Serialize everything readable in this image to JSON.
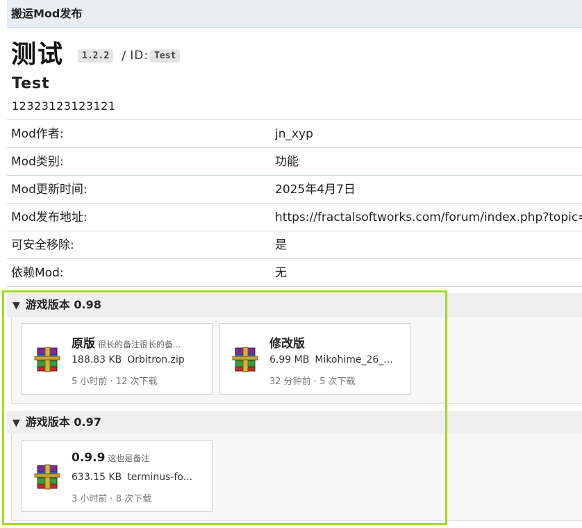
{
  "header": {
    "title": "搬运Mod发布"
  },
  "mod": {
    "title": "测试",
    "version": "1.2.2",
    "id_separator": "/",
    "id_label": "ID:",
    "id": "Test",
    "name": "Test",
    "description": "12323123123121"
  },
  "info": [
    {
      "label": "Mod作者:",
      "value": "jn_xyp"
    },
    {
      "label": "Mod类别:",
      "value": "功能"
    },
    {
      "label": "Mod更新时间:",
      "value": "2025年4月7日"
    },
    {
      "label": "Mod发布地址:",
      "value": "https://fractalsoftworks.com/forum/index.php?topic="
    },
    {
      "label": "可安全移除:",
      "value": "是"
    },
    {
      "label": "依赖Mod:",
      "value": "无"
    }
  ],
  "groups": [
    {
      "title": "游戏版本 0.98",
      "files": [
        {
          "name": "原版",
          "note": "很长的备注很长的备...",
          "size": "188.83 KB",
          "filename": "Orbitron.zip",
          "meta": "5 小时前 · 12 次下载"
        },
        {
          "name": "修改版",
          "note": "",
          "size": "6.99 MB",
          "filename": "Mikohime_26_...",
          "meta": "32 分钟前 · 5 次下载"
        }
      ]
    },
    {
      "title": "游戏版本 0.97",
      "files": [
        {
          "name": "0.9.9",
          "note": "这也是备注",
          "size": "633.15 KB",
          "filename": "terminus-fo...",
          "meta": "3 小时前 · 8 次下载"
        }
      ]
    }
  ],
  "colors": {
    "highlight": "#9fdc20",
    "header_bg": "#e9eef4"
  },
  "icons": {
    "file": "winrar-archive-icon",
    "toggle": "triangle-down-icon"
  }
}
